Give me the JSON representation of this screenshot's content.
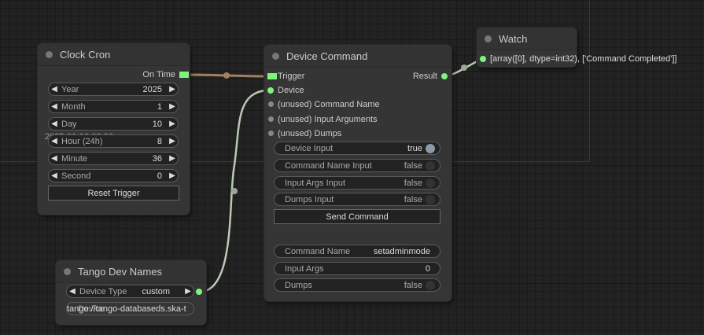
{
  "clock_cron": {
    "title": "Clock Cron",
    "output_on_time": "On Time",
    "widgets": [
      {
        "label": "Year",
        "value": "2025"
      },
      {
        "label": "Month",
        "value": "1"
      },
      {
        "label": "Day",
        "value": "10"
      },
      {
        "label": "Hour (24h)",
        "value": "8"
      },
      {
        "label": "Minute",
        "value": "36"
      },
      {
        "label": "Second",
        "value": "0"
      }
    ],
    "overlap_text": "2025-01-10 08:36",
    "reset_button": "Reset Trigger"
  },
  "device_command": {
    "title": "Device Command",
    "inputs": [
      "Trigger",
      "Device",
      "(unused) Command Name",
      "(unused) Input Arguments",
      "(unused) Dumps"
    ],
    "output_result": "Result",
    "toggles": [
      {
        "label": "Device Input",
        "value": "true"
      },
      {
        "label": "Command Name Input",
        "value": "false"
      },
      {
        "label": "Input Args Input",
        "value": "false"
      },
      {
        "label": "Dumps Input",
        "value": "false"
      }
    ],
    "send_button": "Send Command",
    "fields": [
      {
        "label": "Command Name",
        "value": "setadminmode"
      },
      {
        "label": "Input Args",
        "value": "0"
      },
      {
        "label": "Dumps",
        "value": "false"
      }
    ]
  },
  "watch": {
    "title": "Watch",
    "value": "[array([0], dtype=int32), ['Command Completed']]"
  },
  "tango_dev_names": {
    "title": "Tango Dev Names",
    "device_type_label": "Device Type",
    "device_type_value": "custom",
    "device_overlap_label": "Device",
    "device_value": "tango://tango-databaseds.ska-t"
  }
}
